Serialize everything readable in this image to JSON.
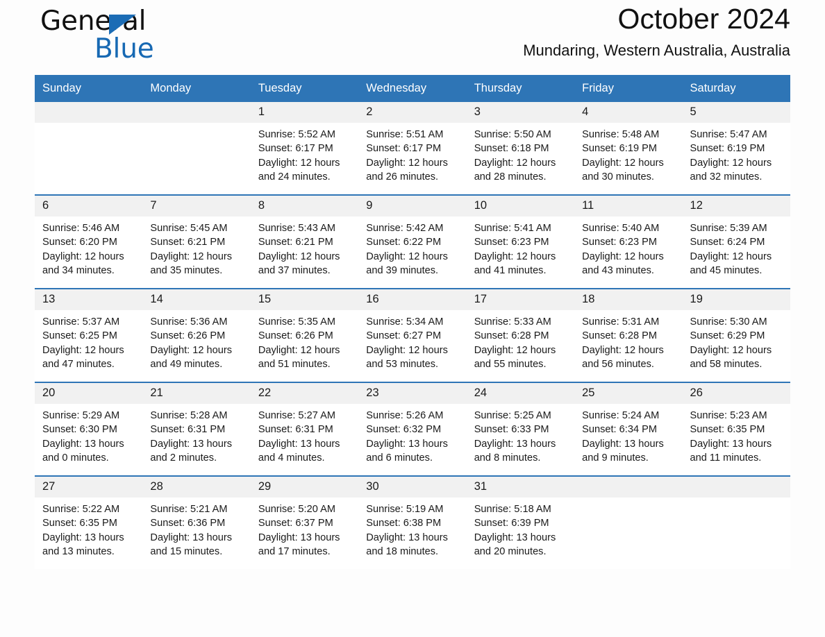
{
  "brand": {
    "word1": "General",
    "word2": "Blue",
    "triangle_color": "#1b6cb5",
    "word2_color": "#1769b3"
  },
  "header": {
    "title": "October 2024",
    "subtitle": "Mundaring, Western Australia, Australia",
    "accent_color": "#2e75b6",
    "daynum_band_color": "#f1f1f1"
  },
  "weekdays": [
    "Sunday",
    "Monday",
    "Tuesday",
    "Wednesday",
    "Thursday",
    "Friday",
    "Saturday"
  ],
  "labels": {
    "sunrise_prefix": "Sunrise:",
    "sunset_prefix": "Sunset:",
    "daylight_prefix": "Daylight:"
  },
  "weeks": [
    [
      {
        "day": "",
        "blank": true
      },
      {
        "day": "",
        "blank": true
      },
      {
        "day": "1",
        "sunrise": "Sunrise: 5:52 AM",
        "sunset": "Sunset: 6:17 PM",
        "daylight": "Daylight: 12 hours and 24 minutes."
      },
      {
        "day": "2",
        "sunrise": "Sunrise: 5:51 AM",
        "sunset": "Sunset: 6:17 PM",
        "daylight": "Daylight: 12 hours and 26 minutes."
      },
      {
        "day": "3",
        "sunrise": "Sunrise: 5:50 AM",
        "sunset": "Sunset: 6:18 PM",
        "daylight": "Daylight: 12 hours and 28 minutes."
      },
      {
        "day": "4",
        "sunrise": "Sunrise: 5:48 AM",
        "sunset": "Sunset: 6:19 PM",
        "daylight": "Daylight: 12 hours and 30 minutes."
      },
      {
        "day": "5",
        "sunrise": "Sunrise: 5:47 AM",
        "sunset": "Sunset: 6:19 PM",
        "daylight": "Daylight: 12 hours and 32 minutes."
      }
    ],
    [
      {
        "day": "6",
        "sunrise": "Sunrise: 5:46 AM",
        "sunset": "Sunset: 6:20 PM",
        "daylight": "Daylight: 12 hours and 34 minutes."
      },
      {
        "day": "7",
        "sunrise": "Sunrise: 5:45 AM",
        "sunset": "Sunset: 6:21 PM",
        "daylight": "Daylight: 12 hours and 35 minutes."
      },
      {
        "day": "8",
        "sunrise": "Sunrise: 5:43 AM",
        "sunset": "Sunset: 6:21 PM",
        "daylight": "Daylight: 12 hours and 37 minutes."
      },
      {
        "day": "9",
        "sunrise": "Sunrise: 5:42 AM",
        "sunset": "Sunset: 6:22 PM",
        "daylight": "Daylight: 12 hours and 39 minutes."
      },
      {
        "day": "10",
        "sunrise": "Sunrise: 5:41 AM",
        "sunset": "Sunset: 6:23 PM",
        "daylight": "Daylight: 12 hours and 41 minutes."
      },
      {
        "day": "11",
        "sunrise": "Sunrise: 5:40 AM",
        "sunset": "Sunset: 6:23 PM",
        "daylight": "Daylight: 12 hours and 43 minutes."
      },
      {
        "day": "12",
        "sunrise": "Sunrise: 5:39 AM",
        "sunset": "Sunset: 6:24 PM",
        "daylight": "Daylight: 12 hours and 45 minutes."
      }
    ],
    [
      {
        "day": "13",
        "sunrise": "Sunrise: 5:37 AM",
        "sunset": "Sunset: 6:25 PM",
        "daylight": "Daylight: 12 hours and 47 minutes."
      },
      {
        "day": "14",
        "sunrise": "Sunrise: 5:36 AM",
        "sunset": "Sunset: 6:26 PM",
        "daylight": "Daylight: 12 hours and 49 minutes."
      },
      {
        "day": "15",
        "sunrise": "Sunrise: 5:35 AM",
        "sunset": "Sunset: 6:26 PM",
        "daylight": "Daylight: 12 hours and 51 minutes."
      },
      {
        "day": "16",
        "sunrise": "Sunrise: 5:34 AM",
        "sunset": "Sunset: 6:27 PM",
        "daylight": "Daylight: 12 hours and 53 minutes."
      },
      {
        "day": "17",
        "sunrise": "Sunrise: 5:33 AM",
        "sunset": "Sunset: 6:28 PM",
        "daylight": "Daylight: 12 hours and 55 minutes."
      },
      {
        "day": "18",
        "sunrise": "Sunrise: 5:31 AM",
        "sunset": "Sunset: 6:28 PM",
        "daylight": "Daylight: 12 hours and 56 minutes."
      },
      {
        "day": "19",
        "sunrise": "Sunrise: 5:30 AM",
        "sunset": "Sunset: 6:29 PM",
        "daylight": "Daylight: 12 hours and 58 minutes."
      }
    ],
    [
      {
        "day": "20",
        "sunrise": "Sunrise: 5:29 AM",
        "sunset": "Sunset: 6:30 PM",
        "daylight": "Daylight: 13 hours and 0 minutes."
      },
      {
        "day": "21",
        "sunrise": "Sunrise: 5:28 AM",
        "sunset": "Sunset: 6:31 PM",
        "daylight": "Daylight: 13 hours and 2 minutes."
      },
      {
        "day": "22",
        "sunrise": "Sunrise: 5:27 AM",
        "sunset": "Sunset: 6:31 PM",
        "daylight": "Daylight: 13 hours and 4 minutes."
      },
      {
        "day": "23",
        "sunrise": "Sunrise: 5:26 AM",
        "sunset": "Sunset: 6:32 PM",
        "daylight": "Daylight: 13 hours and 6 minutes."
      },
      {
        "day": "24",
        "sunrise": "Sunrise: 5:25 AM",
        "sunset": "Sunset: 6:33 PM",
        "daylight": "Daylight: 13 hours and 8 minutes."
      },
      {
        "day": "25",
        "sunrise": "Sunrise: 5:24 AM",
        "sunset": "Sunset: 6:34 PM",
        "daylight": "Daylight: 13 hours and 9 minutes."
      },
      {
        "day": "26",
        "sunrise": "Sunrise: 5:23 AM",
        "sunset": "Sunset: 6:35 PM",
        "daylight": "Daylight: 13 hours and 11 minutes."
      }
    ],
    [
      {
        "day": "27",
        "sunrise": "Sunrise: 5:22 AM",
        "sunset": "Sunset: 6:35 PM",
        "daylight": "Daylight: 13 hours and 13 minutes."
      },
      {
        "day": "28",
        "sunrise": "Sunrise: 5:21 AM",
        "sunset": "Sunset: 6:36 PM",
        "daylight": "Daylight: 13 hours and 15 minutes."
      },
      {
        "day": "29",
        "sunrise": "Sunrise: 5:20 AM",
        "sunset": "Sunset: 6:37 PM",
        "daylight": "Daylight: 13 hours and 17 minutes."
      },
      {
        "day": "30",
        "sunrise": "Sunrise: 5:19 AM",
        "sunset": "Sunset: 6:38 PM",
        "daylight": "Daylight: 13 hours and 18 minutes."
      },
      {
        "day": "31",
        "sunrise": "Sunrise: 5:18 AM",
        "sunset": "Sunset: 6:39 PM",
        "daylight": "Daylight: 13 hours and 20 minutes."
      },
      {
        "day": "",
        "blank": true
      },
      {
        "day": "",
        "blank": true
      }
    ]
  ]
}
